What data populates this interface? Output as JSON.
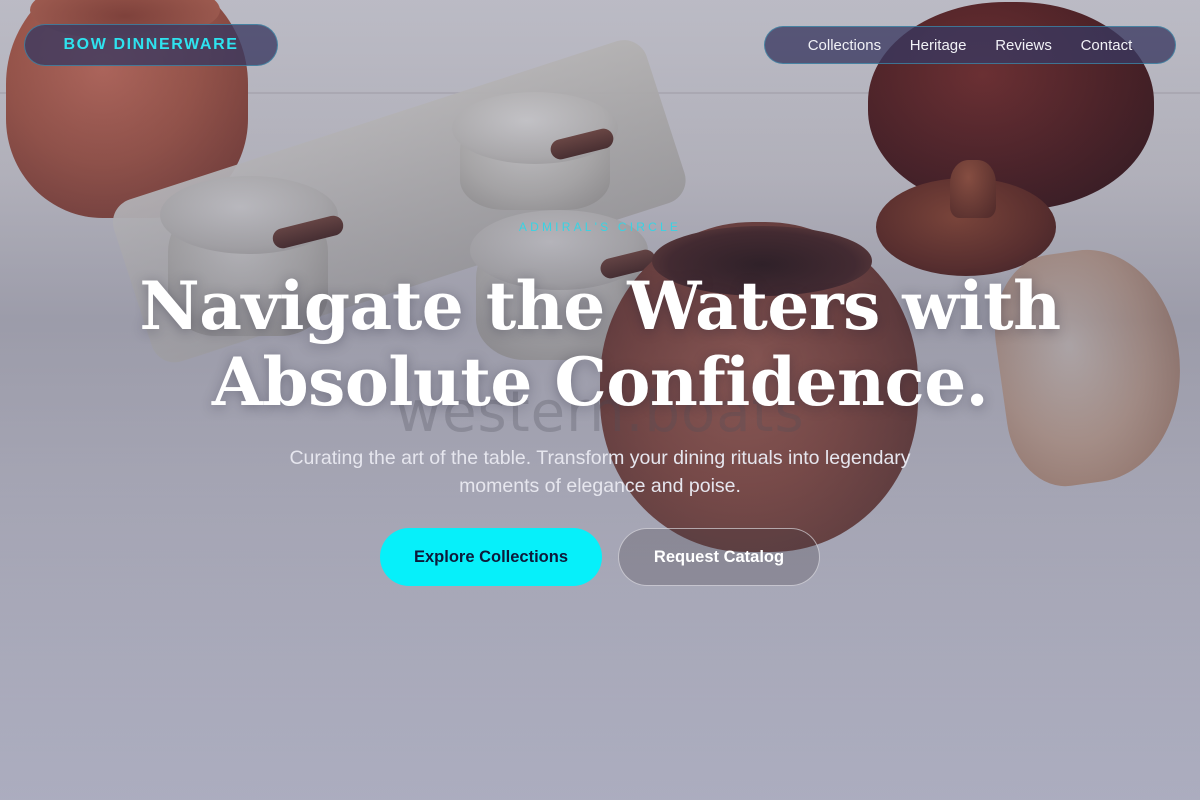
{
  "brand": {
    "name": "BOW DINNERWARE"
  },
  "nav": {
    "items": [
      {
        "label": "Collections"
      },
      {
        "label": "Heritage"
      },
      {
        "label": "Reviews"
      },
      {
        "label": "Contact"
      }
    ]
  },
  "hero": {
    "eyebrow": "ADMIRAL'S CIRCLE",
    "headline_line1": "Navigate the Waters with",
    "headline_line2": "Absolute Confidence.",
    "subtitle": "Curating the art of the table. Transform your dining rituals into legendary moments of elegance and poise.",
    "watermark": "western.boats"
  },
  "actions": {
    "primary_label": "Explore Collections",
    "secondary_label": "Request Catalog"
  },
  "colors": {
    "accent": "#06f0fa",
    "brand_text": "#2ee3ef",
    "pill_background": "#3a3860"
  }
}
